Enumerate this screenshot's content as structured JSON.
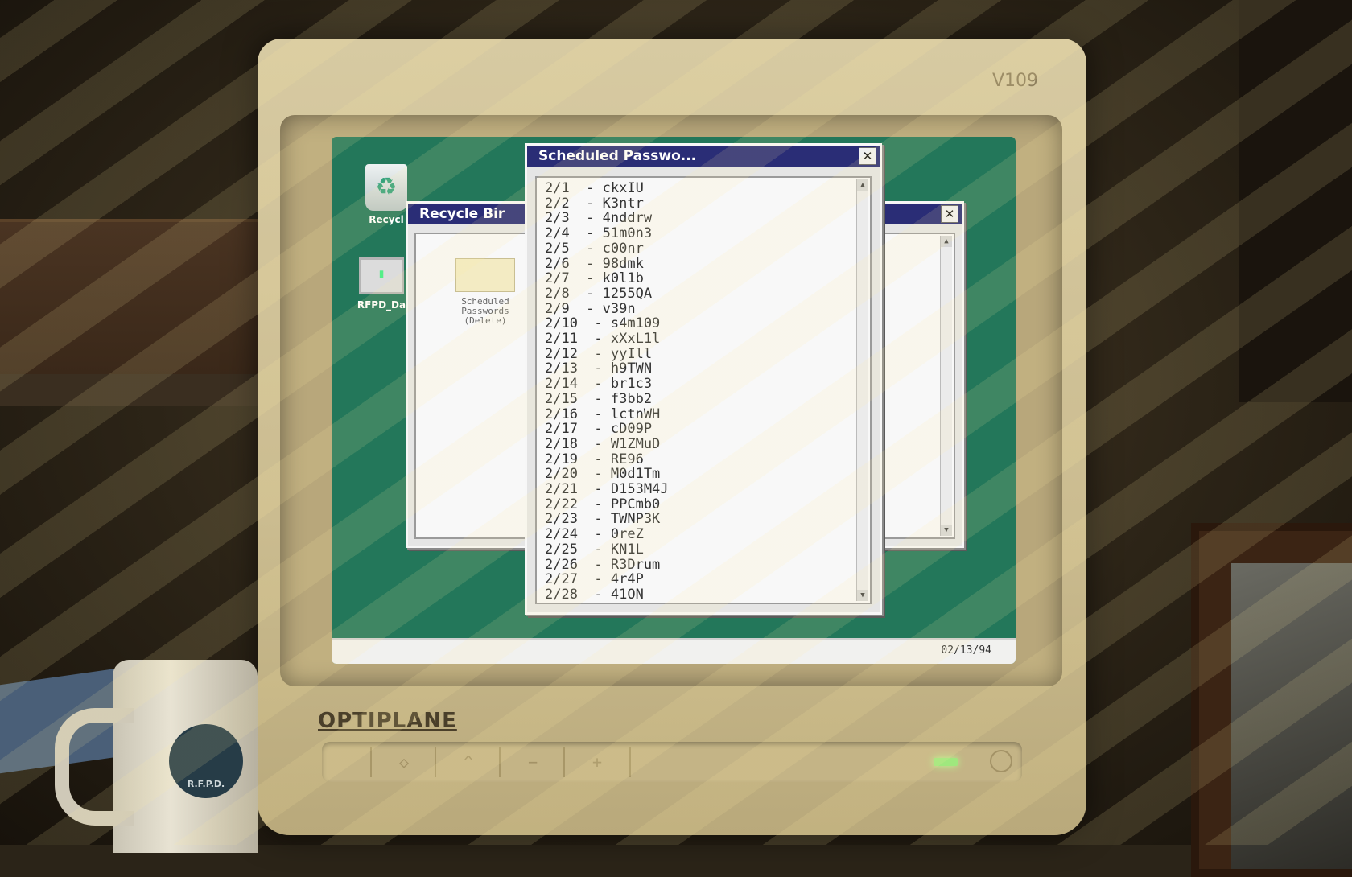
{
  "monitor": {
    "model_label": "V109",
    "brand": "OPTIPLANE",
    "controls": [
      "◇",
      "^",
      "−",
      "+"
    ]
  },
  "desktop": {
    "icons": [
      {
        "label": "Recycl",
        "icon": "recycle-bin-icon"
      },
      {
        "label": "RFPD_Da",
        "icon": "computer-icon"
      }
    ],
    "taskbar": {
      "date": "02/13/94"
    }
  },
  "recycle_window": {
    "title": "Recycle Bir",
    "close_label": "✕",
    "folder": {
      "label": "Scheduled\nPasswords\n(Delete)",
      "icon": "folder-icon"
    }
  },
  "back_window": {
    "close_label": "✕"
  },
  "passwords_window": {
    "title": "Scheduled Passwo...",
    "close_label": "✕",
    "entries": [
      "2/1  - ckxIU",
      "2/2  - K3ntr",
      "2/3  - 4nddrw",
      "2/4  - 51m0n3",
      "2/5  - c00nr",
      "2/6  - 98dmk",
      "2/7  - k0l1b",
      "2/8  - 1255QA",
      "2/9  - v39n",
      "2/10  - s4m109",
      "2/11  - xXxL1l",
      "2/12  - yyIll",
      "2/13  - h9TWN",
      "2/14  - br1c3",
      "2/15  - f3bb2",
      "2/16  - lctnWH",
      "2/17  - cD09P",
      "2/18  - W1ZMuD",
      "2/19  - RE96",
      "2/20  - M0d1Tm",
      "2/21  - D153M4J",
      "2/22  - PPCmb0",
      "2/23  - TWNP3K",
      "2/24  - 0reZ",
      "2/25  - KN1L",
      "2/26  - R3Drum",
      "2/27  - 4r4P",
      "2/28  - 41ON"
    ]
  },
  "mug": {
    "logo_text": "R.F.P.D."
  }
}
